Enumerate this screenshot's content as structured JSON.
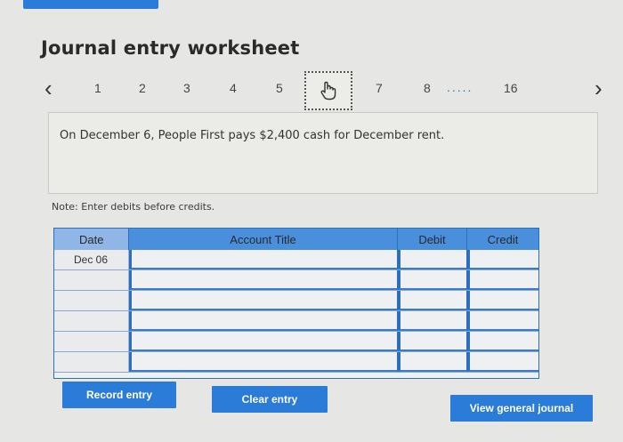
{
  "title": "Journal entry worksheet",
  "pager": {
    "prev_icon": "chevron-left-icon",
    "next_icon": "chevron-right-icon",
    "pages": [
      "1",
      "2",
      "3",
      "4",
      "5",
      "7",
      "8"
    ],
    "ellipsis": ".....",
    "last_page": "16",
    "current_indicator": "hand-cursor-icon"
  },
  "prompt": "On December 6, People First pays $2,400 cash for December rent.",
  "note": "Note: Enter debits before credits.",
  "table": {
    "headers": {
      "date": "Date",
      "account": "Account Title",
      "debit": "Debit",
      "credit": "Credit"
    },
    "rows": [
      {
        "date": "Dec 06"
      },
      {
        "date": ""
      },
      {
        "date": ""
      },
      {
        "date": ""
      },
      {
        "date": ""
      },
      {
        "date": ""
      }
    ]
  },
  "buttons": {
    "record": "Record entry",
    "clear": "Clear entry",
    "view": "View general journal"
  },
  "colors": {
    "accent": "#2b7bd9",
    "header": "#4a8fdc"
  }
}
